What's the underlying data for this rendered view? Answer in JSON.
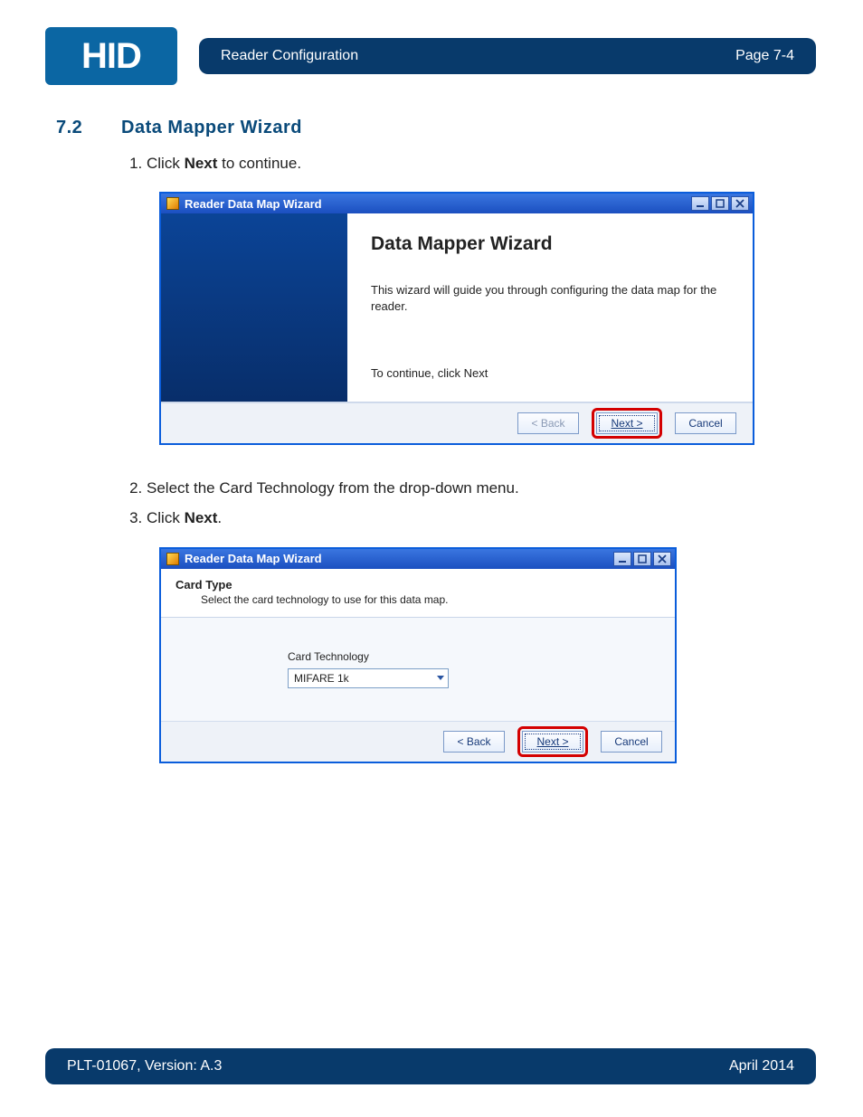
{
  "header": {
    "logo_text": "HID",
    "title": "Reader Configuration",
    "page_label": "Page 7-4"
  },
  "footer": {
    "doc_version": "PLT-01067, Version: A.3",
    "date": "April 2014"
  },
  "section": {
    "number": "7.2",
    "title": "Data Mapper Wizard"
  },
  "steps": {
    "s1_pre": "Click ",
    "s1_bold": "Next",
    "s1_post": " to continue.",
    "s2": "Select the Card Technology from the drop-down menu.",
    "s3_pre": "Click ",
    "s3_bold": "Next",
    "s3_post": "."
  },
  "wizard1": {
    "window_title": "Reader Data Map Wizard",
    "heading": "Data Mapper Wizard",
    "intro": "This wizard will guide you through configuring the data map for the reader.",
    "continue_hint": "To continue, click Next",
    "btn_back": "< Back",
    "btn_next": "Next >",
    "btn_cancel": "Cancel"
  },
  "wizard2": {
    "window_title": "Reader Data Map Wizard",
    "head": "Card Type",
    "subhead": "Select the card technology to use for this data map.",
    "field_label": "Card Technology",
    "field_value": "MIFARE 1k",
    "btn_back": "< Back",
    "btn_next": "Next >",
    "btn_cancel": "Cancel"
  }
}
